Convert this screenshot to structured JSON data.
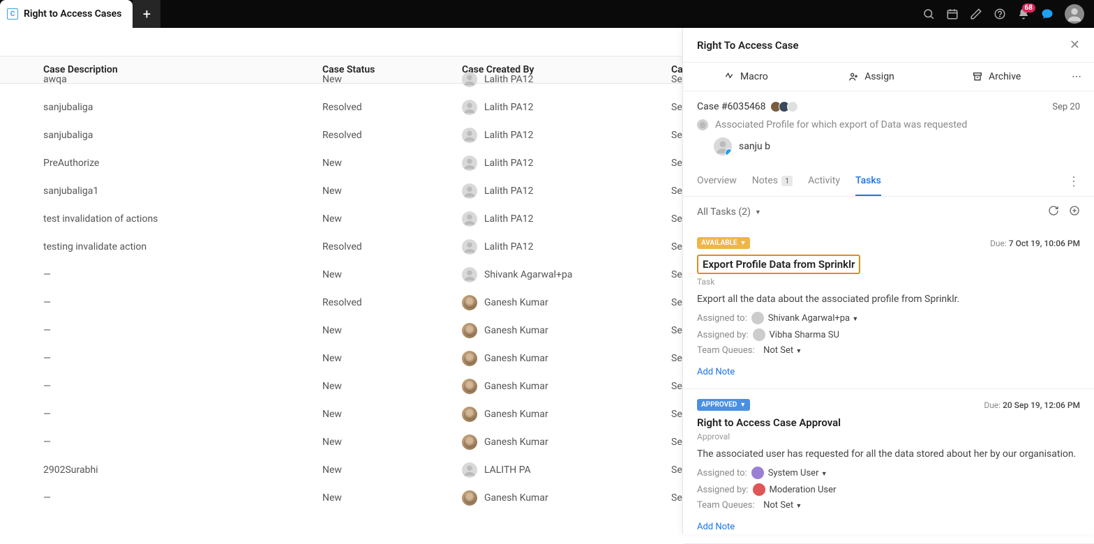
{
  "tab": {
    "label": "Right to Access Cases"
  },
  "notif_count": "68",
  "table": {
    "headers": {
      "desc": "Case Description",
      "status": "Case Status",
      "created": "Case Created By",
      "last": "Ca"
    },
    "rows": [
      {
        "desc": "awqa",
        "status": "New",
        "user": "Lalith PA12",
        "avatar": "gray",
        "last": "Se"
      },
      {
        "desc": "sanjubaliga",
        "status": "Resolved",
        "user": "Lalith PA12",
        "avatar": "gray",
        "last": "Se"
      },
      {
        "desc": "sanjubaliga",
        "status": "Resolved",
        "user": "Lalith PA12",
        "avatar": "gray",
        "last": "Se"
      },
      {
        "desc": "PreAuthorize",
        "status": "New",
        "user": "Lalith PA12",
        "avatar": "gray",
        "last": "Se"
      },
      {
        "desc": "sanjubaliga1",
        "status": "New",
        "user": "Lalith PA12",
        "avatar": "gray",
        "last": "Se"
      },
      {
        "desc": "test invalidation of actions",
        "status": "New",
        "user": "Lalith PA12",
        "avatar": "gray",
        "last": "Se"
      },
      {
        "desc": "testing invalidate action",
        "status": "Resolved",
        "user": "Lalith PA12",
        "avatar": "gray",
        "last": "Se"
      },
      {
        "desc": "—",
        "status": "New",
        "user": "Shivank Agarwal+pa",
        "avatar": "gray",
        "last": "Se"
      },
      {
        "desc": "—",
        "status": "Resolved",
        "user": "Ganesh Kumar",
        "avatar": "photo",
        "last": "Se"
      },
      {
        "desc": "—",
        "status": "New",
        "user": "Ganesh Kumar",
        "avatar": "photo",
        "last": "Se"
      },
      {
        "desc": "—",
        "status": "New",
        "user": "Ganesh Kumar",
        "avatar": "photo",
        "last": "Se"
      },
      {
        "desc": "—",
        "status": "New",
        "user": "Ganesh Kumar",
        "avatar": "photo",
        "last": "Se"
      },
      {
        "desc": "—",
        "status": "New",
        "user": "Ganesh Kumar",
        "avatar": "photo",
        "last": "Se"
      },
      {
        "desc": "—",
        "status": "New",
        "user": "Ganesh Kumar",
        "avatar": "photo",
        "last": "Se"
      },
      {
        "desc": "2902Surabhi",
        "status": "New",
        "user": "LALITH PA",
        "avatar": "gray",
        "last": "Se"
      },
      {
        "desc": "—",
        "status": "New",
        "user": "Ganesh Kumar",
        "avatar": "photo",
        "last": "Se"
      }
    ]
  },
  "panel": {
    "title": "Right To Access Case",
    "actions": {
      "macro": "Macro",
      "assign": "Assign",
      "archive": "Archive"
    },
    "case": {
      "number": "Case #6035468",
      "date": "Sep 20",
      "assoc_label": "Associated Profile for which export of Data was requested",
      "profile_name": "sanju b"
    },
    "tabs": {
      "overview": "Overview",
      "notes": "Notes",
      "notes_count": "1",
      "activity": "Activity",
      "tasks": "Tasks"
    },
    "tasks_filter": "All Tasks (2)",
    "tasks": [
      {
        "status_label": "AVAILABLE",
        "status_class": "available",
        "due_label": "Due:",
        "due_value": "7 Oct 19, 10:06 PM",
        "title": "Export Profile Data from Sprinklr",
        "highlighted": true,
        "type": "Task",
        "desc": "Export all the data about the associated profile from Sprinklr.",
        "assigned_to_label": "Assigned to:",
        "assigned_to": "Shivank Agarwal+pa",
        "assigned_to_av": "gray",
        "assigned_by_label": "Assigned by:",
        "assigned_by": "Vibha Sharma SU",
        "assigned_by_av": "gray",
        "queues_label": "Team Queues:",
        "queues_value": "Not Set",
        "add_note": "Add Note"
      },
      {
        "status_label": "APPROVED",
        "status_class": "approved",
        "due_label": "Due:",
        "due_value": "20 Sep 19, 12:06 PM",
        "title": "Right to Access Case Approval",
        "highlighted": false,
        "type": "Approval",
        "desc": "The associated user has requested for all the data stored about her by our organisation.",
        "assigned_to_label": "Assigned to:",
        "assigned_to": "System User",
        "assigned_to_av": "purple",
        "assigned_by_label": "Assigned by:",
        "assigned_by": "Moderation User",
        "assigned_by_av": "red",
        "queues_label": "Team Queues:",
        "queues_value": "Not Set",
        "add_note": "Add Note"
      }
    ]
  }
}
